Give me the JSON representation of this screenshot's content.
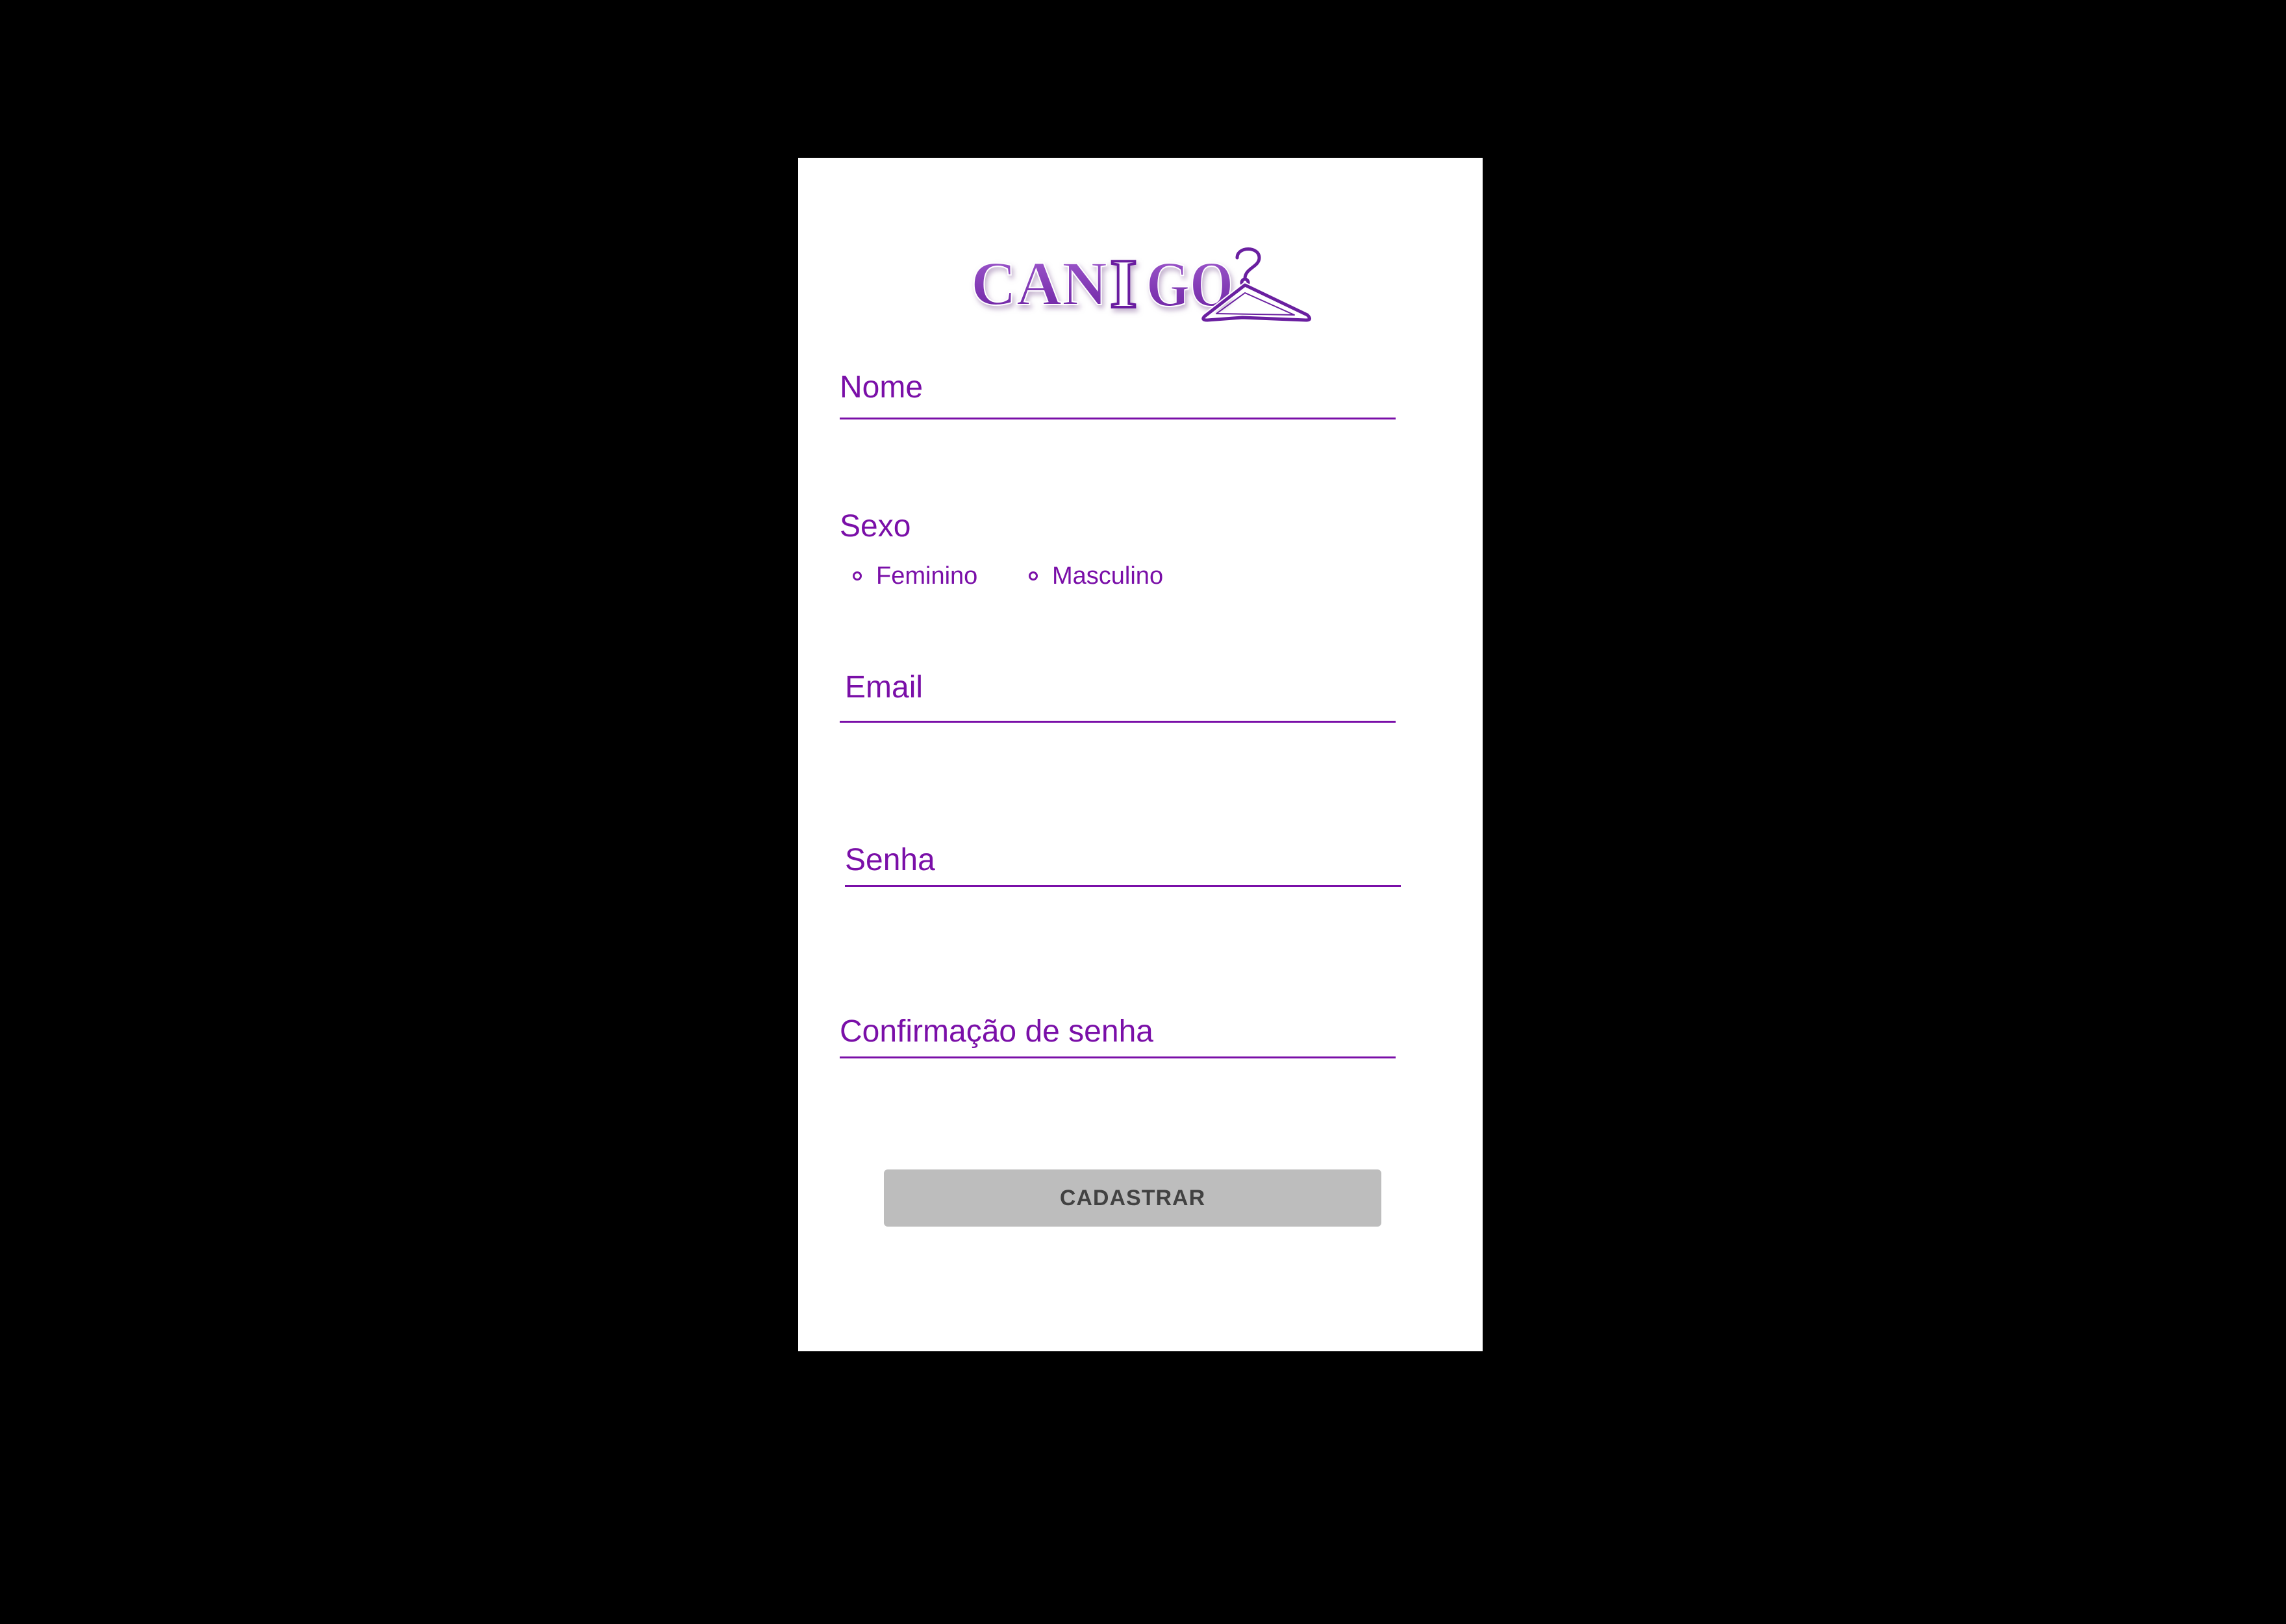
{
  "app": {
    "logo_text": "CANIGO"
  },
  "form": {
    "name_placeholder": "Nome",
    "sex": {
      "label": "Sexo",
      "options": [
        "Feminino",
        "Masculino"
      ]
    },
    "email_placeholder": "Email",
    "password_placeholder": "Senha",
    "password_confirm_placeholder": "Confirmação de senha",
    "submit_label": "CADASTRAR"
  },
  "colors": {
    "accent": "#7a0fa8",
    "button_bg": "#bdbdbd",
    "button_text": "#424242",
    "background": "#000000",
    "surface": "#ffffff"
  },
  "icons": [
    "hanger-icon",
    "radio-unchecked-icon"
  ]
}
